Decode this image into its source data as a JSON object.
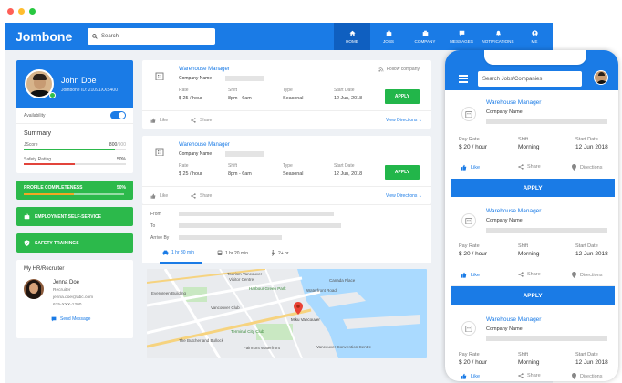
{
  "colors": {
    "brand": "#1a7be6",
    "brand_dark": "#0f5fc0",
    "green": "#22b64a",
    "score_green": "#2cb94b",
    "score_red": "#e2443b"
  },
  "window_dots": [
    "#ff5f57",
    "#ffbd2e",
    "#28c840"
  ],
  "header": {
    "logo": "Jombone",
    "search_placeholder": "Search",
    "nav": [
      {
        "label": "HOME",
        "icon": "home-icon",
        "active": true
      },
      {
        "label": "JOBS",
        "icon": "briefcase-icon",
        "active": false
      },
      {
        "label": "COMPANY",
        "icon": "building-icon",
        "active": false
      },
      {
        "label": "MESSAGES",
        "icon": "message-icon",
        "active": false
      },
      {
        "label": "NOTIFICATIONS",
        "icon": "bell-icon",
        "active": false
      },
      {
        "label": "ME",
        "icon": "user-icon",
        "active": false
      }
    ]
  },
  "profile": {
    "name": "John Doe",
    "id_text": "Jombone ID: 21091XXS400",
    "availability_label": "Availability",
    "summary_title": "Summary",
    "jscore_label": "JScore",
    "jscore_value": "800",
    "jscore_max": "/900",
    "jscore_fraction": 0.89,
    "safety_label": "Safety Rating",
    "safety_value": "50%",
    "safety_fraction": 0.5
  },
  "left_actions": [
    {
      "label": "PROFILE COMPLETENESS",
      "value": "50%",
      "fraction": 0.5,
      "icon": ""
    },
    {
      "label": "EMPLOYMENT SELF-SERVICE",
      "value": "",
      "icon": "briefcase-icon"
    },
    {
      "label": "SAFETY TRAININGS",
      "value": "",
      "icon": "shield-icon"
    }
  ],
  "recruiter": {
    "title": "My HR/Recruiter",
    "name": "Jenna Doe",
    "role": "Recruiter",
    "email": "jenna.doe@abc.com",
    "phone": "675-XXX-1200",
    "send": "Send Message"
  },
  "jobs": [
    {
      "title": "Warehouse Manager",
      "company": "Company Name",
      "follow": "Follow company",
      "rate_label": "Rate",
      "rate": "$ 25 / hour",
      "shift_label": "Shift",
      "shift": "8pm - 6am",
      "type_label": "Type",
      "type": "Seasonal",
      "start_label": "Start Date",
      "start": "12 Jun, 2018",
      "apply": "APPLY",
      "like": "Like",
      "share": "Share",
      "view": "View Directions"
    },
    {
      "title": "Warehouse Manager",
      "company": "Company Name",
      "rate_label": "Rate",
      "rate": "$ 25 / hour",
      "shift_label": "Shift",
      "shift": "8pm - 6am",
      "type_label": "Type",
      "type": "Seasonal",
      "start_label": "Start Date",
      "start": "12 Jun, 2018",
      "apply": "APPLY",
      "like": "Like",
      "share": "Share",
      "view": "View Directions"
    }
  ],
  "directions": {
    "from": "From",
    "to": "To",
    "arrive": "Arrive By",
    "modes": [
      {
        "label": "1 hr 30 min",
        "icon": "car-icon",
        "active": true
      },
      {
        "label": "1 hr 20 min",
        "icon": "bus-icon",
        "active": false
      },
      {
        "label": "2+ hr",
        "icon": "walk-icon",
        "active": false
      }
    ]
  },
  "map": {
    "labels": [
      "Tourism Vancouver",
      "Visitor Centre",
      "Harbour Green Park",
      "Waterfront Road",
      "Canada Place",
      "Vancouver Club",
      "Miku Vancouver",
      "Terminal City Club",
      "The Butcher and Bullock",
      "Evergreen Building",
      "Fairmont Waterfront",
      "Vancouver Convention Centre"
    ]
  },
  "mobile": {
    "search_placeholder": "Search Jobs/Companies",
    "jobs": [
      {
        "title": "Warehouse Manager",
        "company": "Company Name",
        "pay_label": "Pay Rate",
        "pay": "$ 20 / hour",
        "shift_label": "Shift",
        "shift": "Morning",
        "start_label": "Start Date",
        "start": "12 Jun 2018",
        "like": "Like",
        "share": "Share",
        "directions": "Directions",
        "apply": "APPLY"
      },
      {
        "title": "Warehouse Manager",
        "company": "Company Name",
        "pay_label": "Pay Rate",
        "pay": "$ 20 / hour",
        "shift_label": "Shift",
        "shift": "Morning",
        "start_label": "Start Date",
        "start": "12 Jun 2018",
        "like": "Like",
        "share": "Share",
        "directions": "Directions",
        "apply": "APPLY"
      },
      {
        "title": "Warehouse Manager",
        "company": "Company Name",
        "pay_label": "Pay Rate",
        "pay": "$ 20 / hour",
        "shift_label": "Shift",
        "shift": "Morning",
        "start_label": "Start Date",
        "start": "12 Jun 2018",
        "like": "Like",
        "share": "Share",
        "directions": "Directions"
      }
    ]
  }
}
